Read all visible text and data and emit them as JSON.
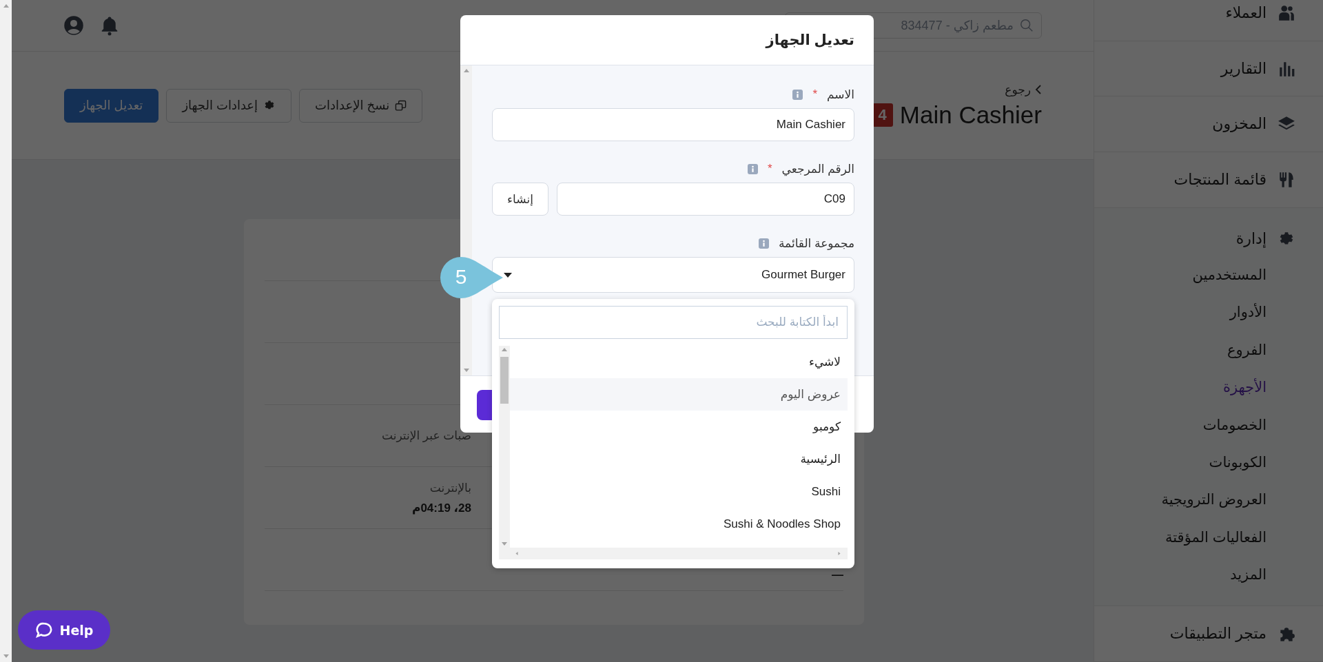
{
  "topbar": {
    "search": {
      "value": "مطعم زاكي - 834477"
    }
  },
  "header": {
    "back_link": "رجوع",
    "title": "Main Cashier",
    "badge": "4",
    "buttons": [
      {
        "label": "نسخ الإعدادات",
        "kind": "copy"
      },
      {
        "label": "إعدادات الجهاز",
        "kind": "settings"
      },
      {
        "label": "تعديل الجهاز",
        "kind": "primary"
      }
    ]
  },
  "details_card": {
    "rows": [
      {
        "label": "صبات عبر الإنترنت"
      },
      {
        "label": "بالإنترنت",
        "value": "28، 04:19م"
      },
      {
        "value": "—"
      }
    ]
  },
  "sidebar": {
    "items": [
      {
        "label": "العملاء",
        "kind": "customers"
      },
      {
        "label": "التقارير",
        "kind": "reports"
      },
      {
        "label": "المخزون",
        "kind": "inventory"
      },
      {
        "label": "قائمة المنتجات",
        "kind": "menu"
      },
      {
        "label": "إدارة",
        "kind": "admin",
        "children": [
          {
            "label": "المستخدمين",
            "selected": false
          },
          {
            "label": "الأدوار",
            "selected": false
          },
          {
            "label": "الفروع",
            "selected": false
          },
          {
            "label": "الأجهزة",
            "selected": true
          },
          {
            "label": "الخصومات",
            "selected": false
          },
          {
            "label": "الكوبونات",
            "selected": false
          },
          {
            "label": "العروض الترويجية",
            "selected": false
          },
          {
            "label": "الفعاليات المؤقتة",
            "selected": false
          },
          {
            "label": "المزيد",
            "selected": false
          }
        ]
      },
      {
        "label": "متجر التطبيقات",
        "kind": "apps"
      }
    ]
  },
  "modal": {
    "title": "تعديل الجهاز",
    "fields": [
      {
        "kind": "text",
        "label": "الاسم",
        "required_mark": "*",
        "value": "Main Cashier"
      },
      {
        "kind": "generate",
        "label": "الرقم المرجعي",
        "required_mark": "*",
        "value": "C09",
        "button": "إنشاء"
      },
      {
        "kind": "select",
        "label": "مجموعة القائمة",
        "value": "Gourmet Burger"
      }
    ]
  },
  "dropdown": {
    "search_placeholder": "ابدأ الكتابة للبحث",
    "options": [
      {
        "label": "لاشيء",
        "selected": false
      },
      {
        "label": "عروض اليوم",
        "selected": true
      },
      {
        "label": "كومبو",
        "selected": false
      },
      {
        "label": "الرئيسية",
        "selected": false
      },
      {
        "label": "Sushi",
        "selected": false
      },
      {
        "label": "Sushi & Noodles Shop",
        "selected": false
      }
    ]
  },
  "callout": {
    "number": "5"
  },
  "help_button": {
    "label": "Help"
  }
}
